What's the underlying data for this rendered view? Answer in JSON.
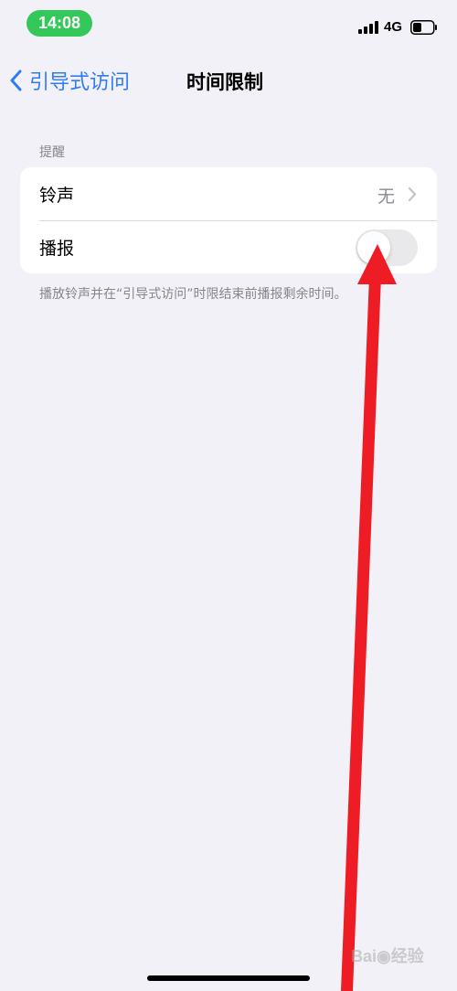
{
  "status_bar": {
    "time": "14:08",
    "network": "4G",
    "icons": [
      "signal-icon",
      "battery-icon"
    ]
  },
  "nav": {
    "back_label": "引导式访问",
    "title": "时间限制",
    "back_icon": "chevron-left-icon",
    "accent_color": "#2f7cf6"
  },
  "section": {
    "header": "提醒",
    "rows": [
      {
        "label": "铃声",
        "value": "无",
        "icon": "chevron-right-icon"
      },
      {
        "label": "播报",
        "toggle_on": false
      }
    ],
    "footer": "播放铃声并在“引导式访问”时限结束前播报剩余时间。"
  },
  "overlay": {
    "arrow_color": "#ee1c25",
    "watermark": "Bai du 经验"
  }
}
